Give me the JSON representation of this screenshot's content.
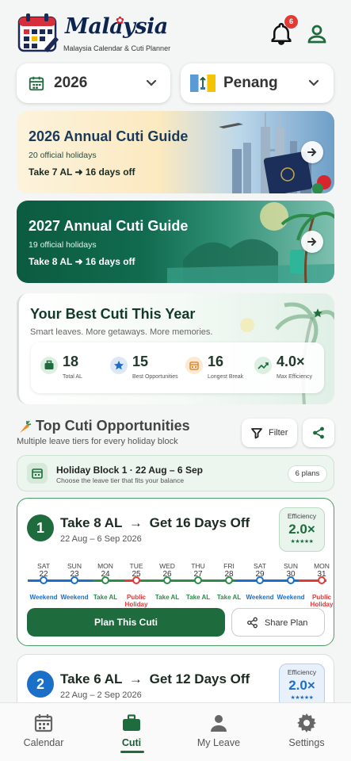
{
  "header": {
    "brand_title": "Malaysia",
    "brand_subtitle": "Malaysia Calendar & Cuti Planner",
    "notification_count": "6"
  },
  "selectors": {
    "year": "2026",
    "state": "Penang"
  },
  "guides": [
    {
      "title": "2026 Annual Cuti Guide",
      "subtitle": "20 official holidays",
      "take": "Take 7 AL ➜ 16 days off"
    },
    {
      "title": "2027 Annual Cuti Guide",
      "subtitle": "19 official holidays",
      "take": "Take 8 AL ➜ 16 days off"
    }
  ],
  "best": {
    "title": "Your Best Cuti This Year",
    "subtitle": "Smart leaves. More getaways. More memories.",
    "stats": [
      {
        "value": "18",
        "label": "Total AL",
        "icon": "briefcase-icon"
      },
      {
        "value": "15",
        "label": "Best Opportunities",
        "icon": "star-icon"
      },
      {
        "value": "16",
        "label": "Longest Break",
        "icon": "calendar-icon"
      },
      {
        "value": "4.0×",
        "label": "Max Efficiency",
        "icon": "trend-icon"
      }
    ]
  },
  "top": {
    "title": "Top Cuti Opportunities",
    "subtitle": "Multiple leave tiers for every holiday block",
    "filter_label": "Filter"
  },
  "block": {
    "title": "Holiday Block 1 · 22 Aug – 6 Sep",
    "subtitle": "Choose the leave tier that fits your balance",
    "plans_label": "6 plans"
  },
  "plans": [
    {
      "rank": "1",
      "take": "Take 8 AL",
      "get": "Get 16 Days Off",
      "dates": "22 Aug – 6 Sep 2026",
      "efficiency_label": "Efficiency",
      "efficiency": "2.0×",
      "stars": "★★★★★",
      "plan_button": "Plan This Cuti",
      "share_button": "Share Plan",
      "days": [
        {
          "name": "SAT",
          "num": "22",
          "type": "Weekend"
        },
        {
          "name": "SUN",
          "num": "23",
          "type": "Weekend"
        },
        {
          "name": "MON",
          "num": "24",
          "type": "Take AL"
        },
        {
          "name": "TUE",
          "num": "25",
          "type": "Public Holiday"
        },
        {
          "name": "WED",
          "num": "26",
          "type": "Take AL"
        },
        {
          "name": "THU",
          "num": "27",
          "type": "Take AL"
        },
        {
          "name": "FRI",
          "num": "28",
          "type": "Take AL"
        },
        {
          "name": "SAT",
          "num": "29",
          "type": "Weekend"
        },
        {
          "name": "SUN",
          "num": "30",
          "type": "Weekend"
        },
        {
          "name": "MON",
          "num": "31",
          "type": "Public Holiday"
        }
      ]
    },
    {
      "rank": "2",
      "take": "Take 6 AL",
      "get": "Get 12 Days Off",
      "dates": "22 Aug – 2 Sep 2026",
      "efficiency_label": "Efficiency",
      "efficiency": "2.0×",
      "stars": "★★★★★"
    }
  ],
  "nav": {
    "items": [
      "Calendar",
      "Cuti",
      "My Leave",
      "Settings"
    ],
    "active": "Cuti"
  },
  "colors": {
    "primary_green": "#1e6b3d",
    "weekend_blue": "#1a6fc9",
    "take_al_green": "#2e8b4a",
    "holiday_red": "#e53935"
  }
}
